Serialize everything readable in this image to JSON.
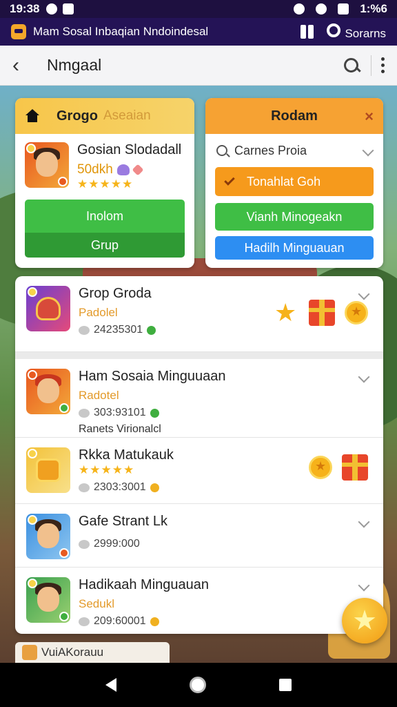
{
  "status_bar": {
    "time": "19:38",
    "battery": "1:%6"
  },
  "notification": {
    "app_name": "Mam Sosal Inbaqian Nndoindesal",
    "account": "Sorarns"
  },
  "topbar": {
    "title": "Nmgaal"
  },
  "group_card": {
    "title": "Grogo",
    "subtitle": "Aseaian",
    "game_name": "Gosian Slodadall",
    "game_price": "50dkh",
    "stars": "★★★★★",
    "primary_button": "Inolom",
    "secondary_button": "Grup"
  },
  "random_card": {
    "title": "Rodam",
    "close": "×",
    "search_dropdown": "Carnes Proia",
    "option_1": "Tonahlat Goh",
    "option_2": "Vianh Minogeakn",
    "option_3": "Hadilh Minguauan"
  },
  "list": {
    "items": [
      {
        "name": "Grop Groda",
        "tag": "Padolel",
        "count": "24235301"
      },
      {
        "name": "Ham Sosaia Minguuaan",
        "tag": "Radotel",
        "count": "303:93101",
        "extra": "Ranets Virionalcl"
      },
      {
        "name": "Rkka Matukauk",
        "stars": "★★★★★",
        "count": "2303:3001"
      },
      {
        "name": "Gafe Strant Lk",
        "count": "2999:000"
      },
      {
        "name": "Hadikaah Minguauan",
        "tag": "Sedukl",
        "count": "209:60001"
      }
    ]
  },
  "peek_chip": {
    "label": "VuiAKorauu"
  },
  "icons": {
    "back": "chevron-left-icon",
    "search": "search-icon",
    "more": "more-vert-icon",
    "fab": "star-icon"
  },
  "colors": {
    "status_bar": "#1e1040",
    "notif_bar": "#241356",
    "group_header": "#f7c64a",
    "random_header": "#f6a233",
    "green_button": "#3fbe45",
    "orange_button": "#f69a1c",
    "blue_button": "#2d8ef2",
    "fab": "#f6b21a"
  }
}
